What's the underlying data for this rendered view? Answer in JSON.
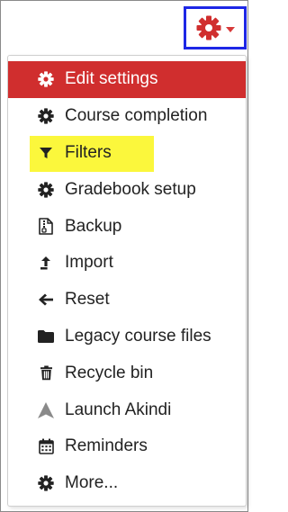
{
  "colors": {
    "accent": "#d02e2e",
    "focus_outline": "#1d27e6",
    "highlight": "#fbf73c",
    "text": "#222222",
    "icon_gray": "#8a8a8a"
  },
  "trigger": {
    "icon": "gear-icon"
  },
  "menu": {
    "items": [
      {
        "label": "Edit settings",
        "icon": "gear-icon",
        "active": true
      },
      {
        "label": "Course completion",
        "icon": "gear-icon"
      },
      {
        "label": "Filters",
        "icon": "filter-icon",
        "highlighted": true
      },
      {
        "label": "Gradebook setup",
        "icon": "gear-icon"
      },
      {
        "label": "Backup",
        "icon": "file-archive-icon"
      },
      {
        "label": "Import",
        "icon": "import-arrow-icon"
      },
      {
        "label": "Reset",
        "icon": "arrow-left-icon"
      },
      {
        "label": "Legacy course files",
        "icon": "folder-icon"
      },
      {
        "label": "Recycle bin",
        "icon": "trash-icon"
      },
      {
        "label": "Launch Akindi",
        "icon": "akindi-logo-icon"
      },
      {
        "label": "Reminders",
        "icon": "calendar-icon"
      },
      {
        "label": "More...",
        "icon": "gear-icon"
      }
    ]
  }
}
